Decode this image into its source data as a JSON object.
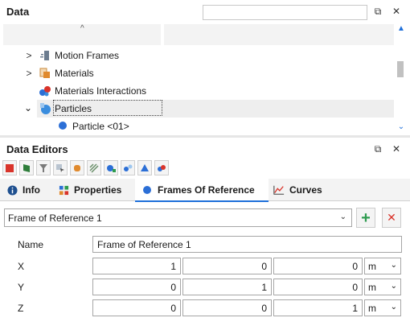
{
  "data_panel": {
    "title": "Data",
    "search_placeholder": "",
    "tree": [
      {
        "label": "Motion Frames",
        "expand": ">"
      },
      {
        "label": "Materials",
        "expand": ">"
      },
      {
        "label": "Materials Interactions",
        "expand": ""
      },
      {
        "label": "Particles",
        "expand": "⌄"
      },
      {
        "label": "Particle <01>",
        "expand": ""
      }
    ]
  },
  "editors_panel": {
    "title": "Data Editors",
    "tabs": [
      "Info",
      "Properties",
      "Frames Of Reference",
      "Curves"
    ],
    "active_tab": "Frames Of Reference"
  },
  "frame_of_reference": {
    "selected": "Frame of Reference 1",
    "name_label": "Name",
    "name_value": "Frame of Reference 1",
    "rows": [
      {
        "label": "X",
        "values": [
          "1",
          "0",
          "0"
        ],
        "unit": "m"
      },
      {
        "label": "Y",
        "values": [
          "0",
          "1",
          "0"
        ],
        "unit": "m"
      },
      {
        "label": "Z",
        "values": [
          "0",
          "0",
          "1"
        ],
        "unit": "m"
      }
    ]
  },
  "colors": {
    "accent": "#1e6fd9",
    "add_green": "#2e9b4f",
    "remove_red": "#d9342b"
  },
  "glyphs": {
    "restore": "⧉",
    "close": "✕",
    "sort_up": "^",
    "scroll_up": "▲",
    "scroll_down": "⌄",
    "dropdown": "⌄",
    "add": "+",
    "remove": "✕"
  }
}
